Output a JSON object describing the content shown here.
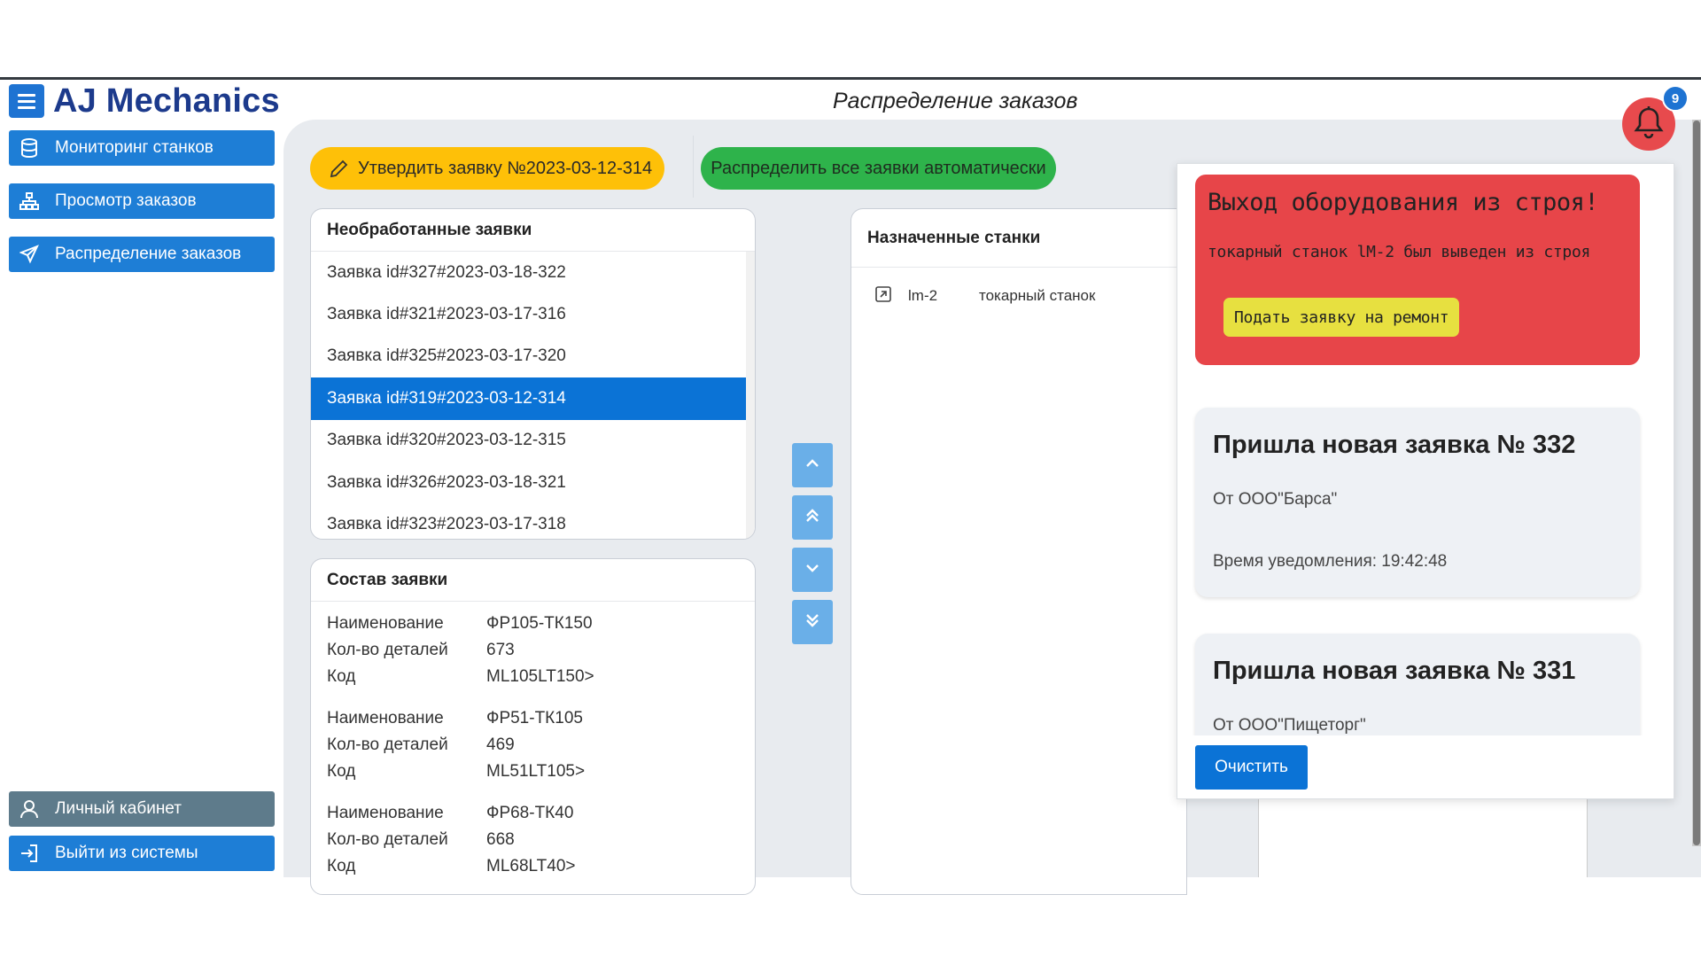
{
  "header": {
    "brand": "AJ Mechanics",
    "page_title": "Распределение заказов"
  },
  "sidebar": {
    "items": [
      {
        "label": "Мониторинг станков",
        "icon": "database-icon"
      },
      {
        "label": "Просмотр заказов",
        "icon": "hierarchy-icon"
      },
      {
        "label": "Распределение заказов",
        "icon": "send-icon"
      }
    ],
    "bottom": [
      {
        "label": "Личный кабинет",
        "icon": "user-icon"
      },
      {
        "label": "Выйти из системы",
        "icon": "logout-icon"
      }
    ]
  },
  "toolbar": {
    "approve_label": "Утвердить заявку №2023-03-12-314",
    "auto_label": "Распределить все заявки автоматически"
  },
  "orders": {
    "title": "Необработанные заявки",
    "items": [
      "Заявка id#327#2023-03-18-322",
      "Заявка id#321#2023-03-17-316",
      "Заявка id#325#2023-03-17-320",
      "Заявка id#319#2023-03-12-314",
      "Заявка id#320#2023-03-12-315",
      "Заявка id#326#2023-03-18-321",
      "Заявка id#323#2023-03-17-318"
    ],
    "selected_index": 3
  },
  "composition": {
    "title": "Состав заявки",
    "keys": {
      "name": "Наименование",
      "qty": "Кол-во деталей",
      "code": "Код"
    },
    "groups": [
      {
        "name": "ФР105-ТК150",
        "qty": "673",
        "code": "ML105LT150>"
      },
      {
        "name": "ФР51-ТК105",
        "qty": "469",
        "code": "ML51LT105>"
      },
      {
        "name": "ФР68-ТК40",
        "qty": "668",
        "code": "ML68LT40>"
      }
    ]
  },
  "machines": {
    "title": "Назначенные станки",
    "items": [
      {
        "name": "lm-2",
        "type": "токарный станок"
      }
    ]
  },
  "notifications": {
    "badge_count": "9",
    "alert": {
      "title": "Выход оборудования из строя!",
      "text": "токарный станок lM-2 был выведен из строя",
      "button": "Подать заявку на ремонт"
    },
    "cards": [
      {
        "title": "Пришла новая заявка № 332",
        "from": "От ООО\"Барса\"",
        "time": "Время уведомления: 19:42:48"
      },
      {
        "title": "Пришла новая заявка № 331",
        "from": "От ООО\"Пищеторг\""
      }
    ],
    "clear_label": "Очистить"
  }
}
